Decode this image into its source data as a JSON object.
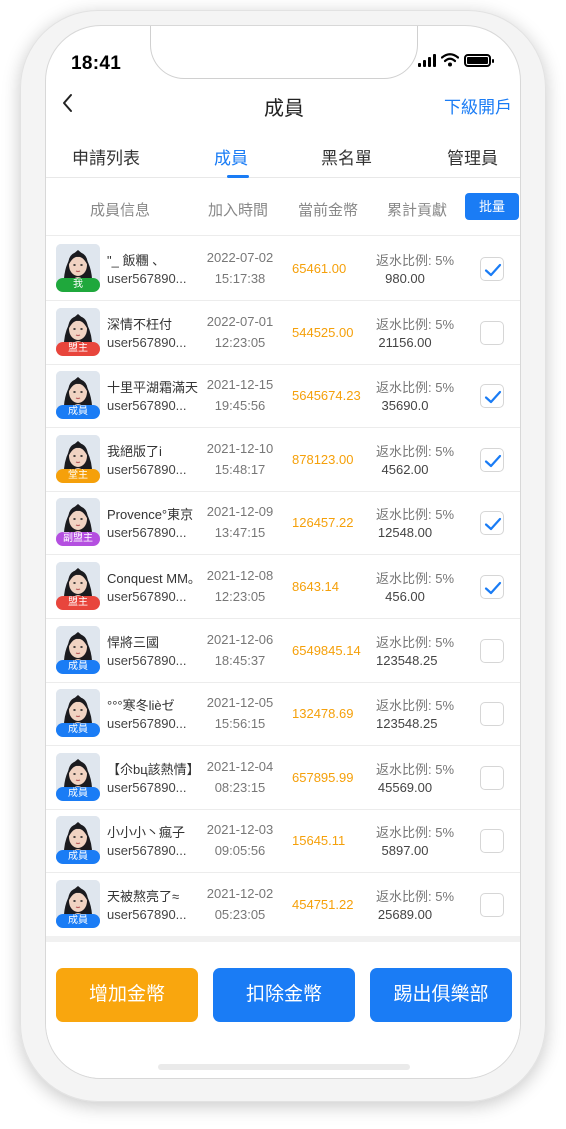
{
  "status_bar": {
    "time": "18:41"
  },
  "nav": {
    "title": "成員",
    "right_link": "下級開戶"
  },
  "tabs": [
    {
      "label": "申請列表"
    },
    {
      "label": "成員",
      "active": true
    },
    {
      "label": "黑名單"
    },
    {
      "label": "管理員"
    }
  ],
  "table_header": {
    "member_info": "成員信息",
    "join_time": "加入時間",
    "current_coins": "當前金幣",
    "contribution": "累計貢獻",
    "batch_button": "批量"
  },
  "rows": [
    {
      "nickname": "\"_ 飯糰 、",
      "user_id": "user567890...",
      "date": "2022-07-02",
      "time": "15:17:38",
      "coins": "65461.00",
      "rate": "返水比例: 5%",
      "contribution": "980.00",
      "role": "我",
      "role_color": "#1fa83c",
      "checked": true
    },
    {
      "nickname": "深情不枉付",
      "user_id": "user567890...",
      "date": "2022-07-01",
      "time": "12:23:05",
      "coins": "544525.00",
      "rate": "返水比例: 5%",
      "contribution": "21156.00",
      "role": "盟主",
      "role_color": "#e8453c",
      "checked": false
    },
    {
      "nickname": "十里平湖霜滿天",
      "user_id": "user567890...",
      "date": "2021-12-15",
      "time": "19:45:56",
      "coins": "5645674.23",
      "rate": "返水比例: 5%",
      "contribution": "35690.0",
      "role": "成員",
      "role_color": "#1a7cf5",
      "checked": true
    },
    {
      "nickname": "我絕版了i",
      "user_id": "user567890...",
      "date": "2021-12-10",
      "time": "15:48:17",
      "coins": "878123.00",
      "rate": "返水比例: 5%",
      "contribution": "4562.00",
      "role": "堂主",
      "role_color": "#f5a00a",
      "checked": true
    },
    {
      "nickname": "Provence°東京",
      "user_id": "user567890...",
      "date": "2021-12-09",
      "time": "13:47:15",
      "coins": "126457.22",
      "rate": "返水比例: 5%",
      "contribution": "12548.00",
      "role": "副盟主",
      "role_color": "#b44fe0",
      "checked": true
    },
    {
      "nickname": "Conquest MM。",
      "user_id": "user567890...",
      "date": "2021-12-08",
      "time": "12:23:05",
      "coins": "8643.14",
      "rate": "返水比例: 5%",
      "contribution": "456.00",
      "role": "盟主",
      "role_color": "#e8453c",
      "checked": true
    },
    {
      "nickname": "悍將三國",
      "user_id": "user567890...",
      "date": "2021-12-06",
      "time": "18:45:37",
      "coins": "6549845.14",
      "rate": "返水比例: 5%",
      "contribution": "123548.25",
      "role": "成員",
      "role_color": "#1a7cf5",
      "checked": false
    },
    {
      "nickname": "°°°寒冬lièゼ",
      "user_id": "user567890...",
      "date": "2021-12-05",
      "time": "15:56:15",
      "coins": "132478.69",
      "rate": "返水比例: 5%",
      "contribution": "123548.25",
      "role": "成員",
      "role_color": "#1a7cf5",
      "checked": false
    },
    {
      "nickname": "【尒bц該熱情】",
      "user_id": "user567890...",
      "date": "2021-12-04",
      "time": "08:23:15",
      "coins": "657895.99",
      "rate": "返水比例: 5%",
      "contribution": "45569.00",
      "role": "成員",
      "role_color": "#1a7cf5",
      "checked": false
    },
    {
      "nickname": "小小小丶瘋子",
      "user_id": "user567890...",
      "date": "2021-12-03",
      "time": "09:05:56",
      "coins": "15645.11",
      "rate": "返水比例: 5%",
      "contribution": "5897.00",
      "role": "成員",
      "role_color": "#1a7cf5",
      "checked": false
    },
    {
      "nickname": "天被熬亮了≈",
      "user_id": "user567890...",
      "date": "2021-12-02",
      "time": "05:23:05",
      "coins": "454751.22",
      "rate": "返水比例: 5%",
      "contribution": "25689.00",
      "role": "成員",
      "role_color": "#1a7cf5",
      "checked": false
    }
  ],
  "actions": [
    {
      "label": "增加金幣",
      "color": "#f9a60e"
    },
    {
      "label": "扣除金幣",
      "color": "#1a7cf5"
    },
    {
      "label": "踢出俱樂部",
      "color": "#1a7cf5"
    }
  ],
  "colors": {
    "accent": "#1a7cf5",
    "coins": "#f5a00a"
  }
}
